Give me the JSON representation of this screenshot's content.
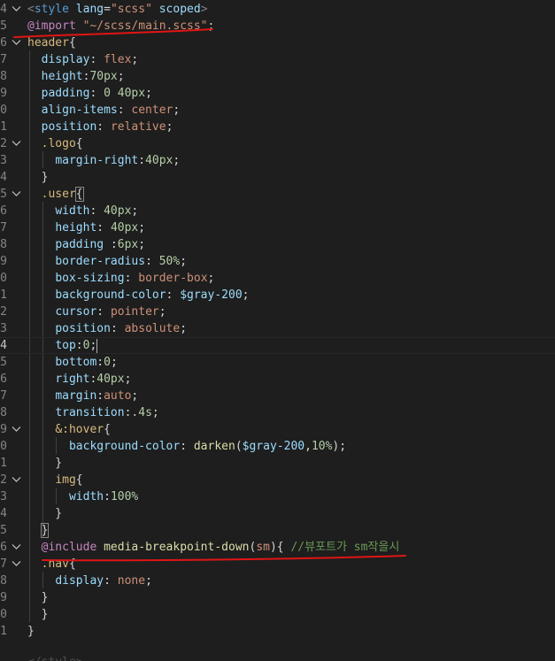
{
  "editor": {
    "language": "scss",
    "lines": [
      {
        "num": "4",
        "fold": "chevron-down",
        "tokens": [
          [
            "tag-bracket",
            "<"
          ],
          [
            "tag",
            "style"
          ],
          [
            "punc",
            " "
          ],
          [
            "attr",
            "lang"
          ],
          [
            "punc",
            "="
          ],
          [
            "str",
            "\"scss\""
          ],
          [
            "punc",
            " "
          ],
          [
            "attr",
            "scoped"
          ],
          [
            "tag-bracket",
            ">"
          ]
        ]
      },
      {
        "num": "5",
        "fold": "",
        "tokens": [
          [
            "at",
            "@import"
          ],
          [
            "punc",
            " "
          ],
          [
            "str",
            "\"~/scss/main.scss\""
          ],
          [
            "punc",
            ";"
          ]
        ]
      },
      {
        "num": "6",
        "fold": "chevron-down",
        "tokens": [
          [
            "sel",
            "header"
          ],
          [
            "punc",
            "{"
          ]
        ]
      },
      {
        "num": "7",
        "fold": "",
        "tokens": [
          [
            "punc",
            "  "
          ],
          [
            "prop",
            "display"
          ],
          [
            "punc",
            ": "
          ],
          [
            "val",
            "flex"
          ],
          [
            "punc",
            ";"
          ]
        ]
      },
      {
        "num": "8",
        "fold": "",
        "tokens": [
          [
            "punc",
            "  "
          ],
          [
            "prop",
            "height"
          ],
          [
            "punc",
            ":"
          ],
          [
            "num",
            "70px"
          ],
          [
            "punc",
            ";"
          ]
        ]
      },
      {
        "num": "9",
        "fold": "",
        "tokens": [
          [
            "punc",
            "  "
          ],
          [
            "prop",
            "padding"
          ],
          [
            "punc",
            ": "
          ],
          [
            "num",
            "0 40px"
          ],
          [
            "punc",
            ";"
          ]
        ]
      },
      {
        "num": "0",
        "fold": "",
        "tokens": [
          [
            "punc",
            "  "
          ],
          [
            "prop",
            "align-items"
          ],
          [
            "punc",
            ": "
          ],
          [
            "val",
            "center"
          ],
          [
            "punc",
            ";"
          ]
        ]
      },
      {
        "num": "1",
        "fold": "",
        "tokens": [
          [
            "punc",
            "  "
          ],
          [
            "prop",
            "position"
          ],
          [
            "punc",
            ": "
          ],
          [
            "val",
            "relative"
          ],
          [
            "punc",
            ";"
          ]
        ]
      },
      {
        "num": "2",
        "fold": "chevron-down",
        "tokens": [
          [
            "punc",
            "  "
          ],
          [
            "sel",
            ".logo"
          ],
          [
            "punc",
            "{"
          ]
        ]
      },
      {
        "num": "3",
        "fold": "",
        "tokens": [
          [
            "punc",
            "    "
          ],
          [
            "prop",
            "margin-right"
          ],
          [
            "punc",
            ":"
          ],
          [
            "num",
            "40px"
          ],
          [
            "punc",
            ";"
          ]
        ]
      },
      {
        "num": "4",
        "fold": "",
        "tokens": [
          [
            "punc",
            "  }"
          ]
        ]
      },
      {
        "num": "5",
        "fold": "chevron-down",
        "tokens": [
          [
            "punc",
            "  "
          ],
          [
            "sel",
            ".user"
          ],
          [
            "brace",
            "{"
          ]
        ]
      },
      {
        "num": "6",
        "fold": "",
        "tokens": [
          [
            "punc",
            "    "
          ],
          [
            "prop",
            "width"
          ],
          [
            "punc",
            ": "
          ],
          [
            "num",
            "40px"
          ],
          [
            "punc",
            ";"
          ]
        ]
      },
      {
        "num": "7",
        "fold": "",
        "tokens": [
          [
            "punc",
            "    "
          ],
          [
            "prop",
            "height"
          ],
          [
            "punc",
            ": "
          ],
          [
            "num",
            "40px"
          ],
          [
            "punc",
            ";"
          ]
        ]
      },
      {
        "num": "8",
        "fold": "",
        "tokens": [
          [
            "punc",
            "    "
          ],
          [
            "prop",
            "padding"
          ],
          [
            "punc",
            " :"
          ],
          [
            "num",
            "6px"
          ],
          [
            "punc",
            ";"
          ]
        ]
      },
      {
        "num": "9",
        "fold": "",
        "tokens": [
          [
            "punc",
            "    "
          ],
          [
            "prop",
            "border-radius"
          ],
          [
            "punc",
            ": "
          ],
          [
            "num",
            "50%"
          ],
          [
            "punc",
            ";"
          ]
        ]
      },
      {
        "num": "0",
        "fold": "",
        "tokens": [
          [
            "punc",
            "    "
          ],
          [
            "prop",
            "box-sizing"
          ],
          [
            "punc",
            ": "
          ],
          [
            "val",
            "border-box"
          ],
          [
            "punc",
            ";"
          ]
        ]
      },
      {
        "num": "1",
        "fold": "",
        "tokens": [
          [
            "punc",
            "    "
          ],
          [
            "prop",
            "background-color"
          ],
          [
            "punc",
            ": "
          ],
          [
            "var",
            "$gray-200"
          ],
          [
            "punc",
            ";"
          ]
        ]
      },
      {
        "num": "2",
        "fold": "",
        "tokens": [
          [
            "punc",
            "    "
          ],
          [
            "prop",
            "cursor"
          ],
          [
            "punc",
            ": "
          ],
          [
            "val",
            "pointer"
          ],
          [
            "punc",
            ";"
          ]
        ]
      },
      {
        "num": "3",
        "fold": "",
        "tokens": [
          [
            "punc",
            "    "
          ],
          [
            "prop",
            "position"
          ],
          [
            "punc",
            ": "
          ],
          [
            "val",
            "absolute"
          ],
          [
            "punc",
            ";"
          ]
        ]
      },
      {
        "num": "4",
        "fold": "",
        "active": true,
        "tokens": [
          [
            "punc",
            "    "
          ],
          [
            "prop",
            "top"
          ],
          [
            "punc",
            ":"
          ],
          [
            "num",
            "0"
          ],
          [
            "punc",
            ";"
          ],
          [
            "caret",
            ""
          ]
        ]
      },
      {
        "num": "5",
        "fold": "",
        "tokens": [
          [
            "punc",
            "    "
          ],
          [
            "prop",
            "bottom"
          ],
          [
            "punc",
            ":"
          ],
          [
            "num",
            "0"
          ],
          [
            "punc",
            ";"
          ]
        ]
      },
      {
        "num": "6",
        "fold": "",
        "tokens": [
          [
            "punc",
            "    "
          ],
          [
            "prop",
            "right"
          ],
          [
            "punc",
            ":"
          ],
          [
            "num",
            "40px"
          ],
          [
            "punc",
            ";"
          ]
        ]
      },
      {
        "num": "7",
        "fold": "",
        "tokens": [
          [
            "punc",
            "    "
          ],
          [
            "prop",
            "margin"
          ],
          [
            "punc",
            ":"
          ],
          [
            "val",
            "auto"
          ],
          [
            "punc",
            ";"
          ]
        ]
      },
      {
        "num": "8",
        "fold": "",
        "tokens": [
          [
            "punc",
            "    "
          ],
          [
            "prop",
            "transition"
          ],
          [
            "punc",
            ":"
          ],
          [
            "num",
            ".4s"
          ],
          [
            "punc",
            ";"
          ]
        ]
      },
      {
        "num": "9",
        "fold": "chevron-down",
        "tokens": [
          [
            "punc",
            "    "
          ],
          [
            "amp",
            "&"
          ],
          [
            "sel",
            ":hover"
          ],
          [
            "punc",
            "{"
          ]
        ]
      },
      {
        "num": "0",
        "fold": "",
        "tokens": [
          [
            "punc",
            "      "
          ],
          [
            "prop",
            "background-color"
          ],
          [
            "punc",
            ": "
          ],
          [
            "fn",
            "darken"
          ],
          [
            "punc",
            "("
          ],
          [
            "var",
            "$gray-200"
          ],
          [
            "punc",
            ","
          ],
          [
            "num",
            "10%"
          ],
          [
            "punc",
            ");"
          ]
        ]
      },
      {
        "num": "1",
        "fold": "",
        "tokens": [
          [
            "punc",
            "    }"
          ]
        ]
      },
      {
        "num": "2",
        "fold": "chevron-down",
        "tokens": [
          [
            "punc",
            "    "
          ],
          [
            "sel",
            "img"
          ],
          [
            "punc",
            "{"
          ]
        ]
      },
      {
        "num": "3",
        "fold": "",
        "tokens": [
          [
            "punc",
            "      "
          ],
          [
            "prop",
            "width"
          ],
          [
            "punc",
            ":"
          ],
          [
            "num",
            "100%"
          ]
        ]
      },
      {
        "num": "4",
        "fold": "",
        "tokens": [
          [
            "punc",
            "    }"
          ]
        ]
      },
      {
        "num": "5",
        "fold": "",
        "tokens": [
          [
            "punc",
            "  "
          ],
          [
            "brace",
            "}"
          ]
        ]
      },
      {
        "num": "6",
        "fold": "chevron-down",
        "tokens": [
          [
            "punc",
            "  "
          ],
          [
            "at",
            "@include"
          ],
          [
            "punc",
            " "
          ],
          [
            "fn",
            "media-breakpoint-down"
          ],
          [
            "punc",
            "("
          ],
          [
            "val",
            "sm"
          ],
          [
            "punc",
            "){ "
          ],
          [
            "cmt",
            "//뷰포트가 sm작을시"
          ]
        ]
      },
      {
        "num": "7",
        "fold": "chevron-down",
        "tokens": [
          [
            "punc",
            "  "
          ],
          [
            "sel",
            ".nav"
          ],
          [
            "punc",
            "{"
          ]
        ]
      },
      {
        "num": "8",
        "fold": "",
        "tokens": [
          [
            "punc",
            "    "
          ],
          [
            "prop",
            "display"
          ],
          [
            "punc",
            ": "
          ],
          [
            "val",
            "none"
          ],
          [
            "punc",
            ";"
          ]
        ]
      },
      {
        "num": "9",
        "fold": "",
        "tokens": [
          [
            "punc",
            "  }"
          ]
        ]
      },
      {
        "num": "0",
        "fold": "",
        "tokens": [
          [
            "punc",
            "  }"
          ]
        ]
      },
      {
        "num": "1",
        "fold": "",
        "tokens": [
          [
            "punc",
            "}"
          ]
        ]
      }
    ]
  },
  "colors": {
    "background": "#1e1e1e",
    "annotation_red": "#e01515"
  }
}
